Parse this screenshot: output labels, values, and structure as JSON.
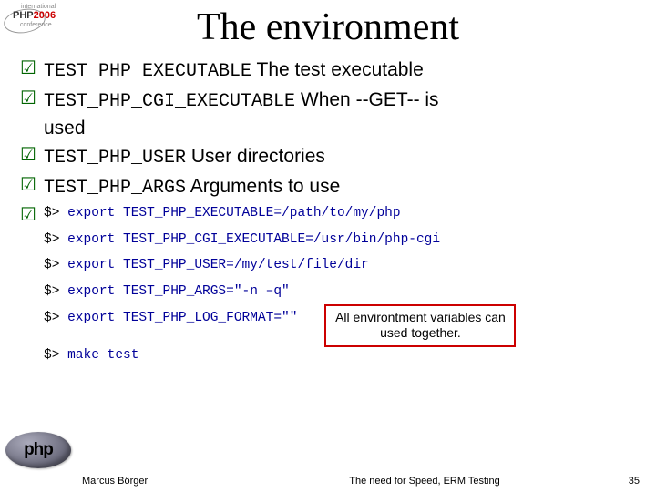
{
  "logo": {
    "line1": "international",
    "line2_a": "PHP",
    "line2_b": "2006",
    "line3": "conference"
  },
  "title": "The environment",
  "bullets": [
    {
      "code": "TEST_PHP_EXECUTABLE",
      "desc": "  The test executable"
    },
    {
      "code": "TEST_PHP_CGI_EXECUTABLE",
      "desc": "   When --GET-- is",
      "cont": "used"
    },
    {
      "code": "TEST_PHP_USER",
      "desc": "  User directories"
    },
    {
      "code": "TEST_PHP_ARGS",
      "desc": "  Arguments to use"
    }
  ],
  "code": {
    "prompt": "$>",
    "lines": [
      "export TEST_PHP_EXECUTABLE=/path/to/my/php",
      "export TEST_PHP_CGI_EXECUTABLE=/usr/bin/php-cgi",
      "export TEST_PHP_USER=/my/test/file/dir",
      "export TEST_PHP_ARGS=\"-n –q\"",
      "export TEST_PHP_LOG_FORMAT=\"\"",
      "make test"
    ]
  },
  "callout": "All environtment variables can used together.",
  "php_logo": "php",
  "footer": {
    "author": "Marcus Börger",
    "title": "The need for Speed, ERM Testing",
    "page": "35"
  }
}
